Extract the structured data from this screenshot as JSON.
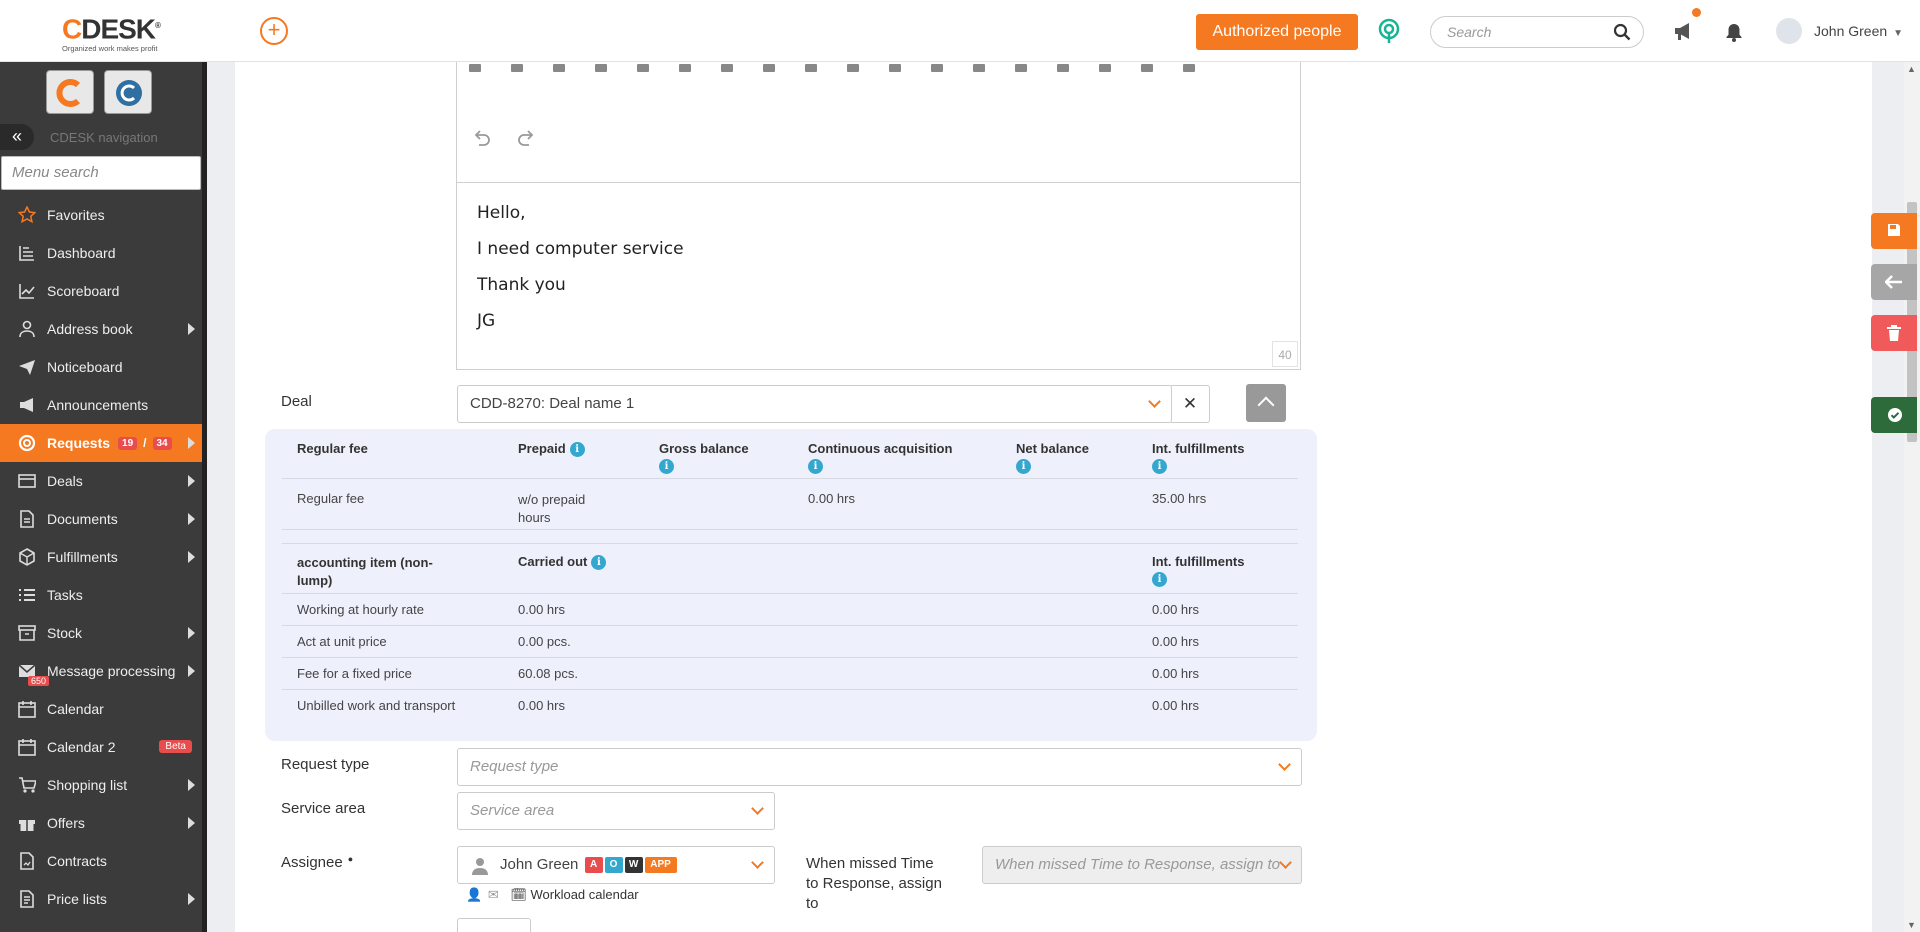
{
  "header": {
    "logo_text": "CDESK",
    "logo_tagline": "Organized work makes profit",
    "authorized_button": "Authorized people",
    "search_placeholder": "Search",
    "user_name": "John Green"
  },
  "sidebar": {
    "nav_title": "CDESK navigation",
    "menu_search_placeholder": "Menu search",
    "items": [
      {
        "label": "Favorites",
        "icon": "star-icon",
        "arrow": false
      },
      {
        "label": "Dashboard",
        "icon": "dashboard-icon",
        "arrow": false
      },
      {
        "label": "Scoreboard",
        "icon": "chart-line-icon",
        "arrow": false
      },
      {
        "label": "Address book",
        "icon": "person-icon",
        "arrow": true
      },
      {
        "label": "Noticeboard",
        "icon": "paper-plane-icon",
        "arrow": false
      },
      {
        "label": "Announcements",
        "icon": "megaphone-icon",
        "arrow": false
      },
      {
        "label": "Requests",
        "icon": "lifebuoy-icon",
        "arrow": true,
        "active": true,
        "badge1": "19",
        "badge2": "34"
      },
      {
        "label": "Deals",
        "icon": "deal-icon",
        "arrow": true
      },
      {
        "label": "Documents",
        "icon": "document-icon",
        "arrow": true
      },
      {
        "label": "Fulfillments",
        "icon": "box-icon",
        "arrow": true
      },
      {
        "label": "Tasks",
        "icon": "tasks-icon",
        "arrow": false
      },
      {
        "label": "Stock",
        "icon": "archive-icon",
        "arrow": true
      },
      {
        "label": "Message processing",
        "icon": "envelope-icon",
        "arrow": true,
        "count": "650"
      },
      {
        "label": "Calendar",
        "icon": "calendar-icon",
        "arrow": false
      },
      {
        "label": "Calendar 2",
        "icon": "calendar-icon",
        "arrow": false,
        "beta": "Beta"
      },
      {
        "label": "Shopping list",
        "icon": "cart-icon",
        "arrow": true
      },
      {
        "label": "Offers",
        "icon": "gift-icon",
        "arrow": true
      },
      {
        "label": "Contracts",
        "icon": "contract-icon",
        "arrow": false
      },
      {
        "label": "Price lists",
        "icon": "price-list-icon",
        "arrow": true
      }
    ]
  },
  "editor": {
    "lines": [
      "Hello,",
      "I need computer service",
      "Thank you",
      "JG"
    ],
    "char_count": "40"
  },
  "deal": {
    "label": "Deal",
    "value": "CDD-8270: Deal name 1"
  },
  "fees": {
    "headers": [
      "Regular fee",
      "Prepaid",
      "Gross balance",
      "Continuous acquisition",
      "Net balance",
      "Int. fulfillments"
    ],
    "row": {
      "name": "Regular fee",
      "prepaid_line1": "w/o prepaid",
      "prepaid_line2": "hours",
      "continuous": "0.00 hrs",
      "int": "35.00 hrs"
    },
    "headers2": {
      "item_line1": "accounting item (non-",
      "item_line2": "lump)",
      "carried": "Carried out",
      "int": "Int. fulfillments"
    },
    "rows2": [
      {
        "name": "Working at hourly rate",
        "carried": "0.00 hrs",
        "int": "0.00 hrs"
      },
      {
        "name": "Act at unit price",
        "carried": "0.00 pcs.",
        "int": "0.00 hrs"
      },
      {
        "name": "Fee for a fixed price",
        "carried": "60.08 pcs.",
        "int": "0.00 hrs"
      },
      {
        "name": "Unbilled work and transport",
        "carried": "0.00 hrs",
        "int": "0.00 hrs"
      }
    ]
  },
  "form": {
    "request_type_label": "Request type",
    "request_type_placeholder": "Request type",
    "service_area_label": "Service area",
    "service_area_placeholder": "Service area",
    "assignee_label": "Assignee",
    "assignee_value": "John Green",
    "assignee_badges": [
      "A",
      "O",
      "W",
      "APP"
    ],
    "workload_link": "Workload calendar",
    "missed_label_line1": "When missed Time",
    "missed_label_line2": "to Response, assign",
    "missed_label_line3": "to",
    "missed_placeholder": "When missed Time to Response, assign to"
  },
  "colors": {
    "accent": "#f47920",
    "sidebar": "#3b3b3b",
    "badge_red": "#e84c4c",
    "info_blue": "#34a7cf",
    "save_green": "#2e6b3a"
  }
}
